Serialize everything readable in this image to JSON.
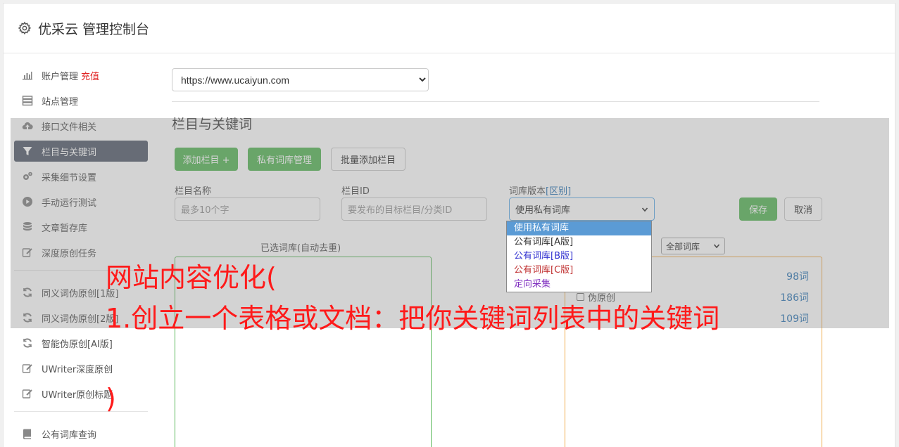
{
  "header": {
    "title": "优采云 管理控制台",
    "icon": "gear-icon"
  },
  "sidebar": {
    "items": [
      {
        "label": "账户管理",
        "icon": "bar-chart-icon",
        "extra": "充值"
      },
      {
        "label": "站点管理",
        "icon": "server-icon"
      },
      {
        "label": "接口文件相关",
        "icon": "cloud-upload-icon"
      },
      {
        "label": "栏目与关键词",
        "icon": "filter-icon",
        "active": true
      },
      {
        "label": "采集细节设置",
        "icon": "cogs-icon"
      },
      {
        "label": "手动运行测试",
        "icon": "play-circle-icon"
      },
      {
        "label": "文章暂存库",
        "icon": "database-icon"
      },
      {
        "label": "深度原创任务",
        "icon": "edit-icon"
      }
    ],
    "items2": [
      {
        "label": "同义词伪原创[1版]",
        "icon": "refresh-icon"
      },
      {
        "label": "同义词伪原创[2版]",
        "icon": "refresh-icon"
      },
      {
        "label": "智能伪原创[AI版]",
        "icon": "refresh-icon"
      },
      {
        "label": "UWriter深度原创",
        "icon": "edit-icon"
      },
      {
        "label": "UWriter原创标题",
        "icon": "edit-icon"
      }
    ],
    "items3": [
      {
        "label": "公有词库查询",
        "icon": "book-icon"
      }
    ]
  },
  "main": {
    "site_select_value": "https://www.ucaiyun.com",
    "section_title": "栏目与关键词",
    "buttons": {
      "add_column": "添加栏目 +",
      "private_lib": "私有词库管理",
      "batch_add": "批量添加栏目"
    },
    "form": {
      "name_label": "栏目名称",
      "name_placeholder": "最多10个字",
      "id_label": "栏目ID",
      "id_placeholder": "要发布的目标栏目/分类ID",
      "version_label": "词库版本",
      "version_diff": "[区别]",
      "version_value": "使用私有词库",
      "save": "保存",
      "cancel": "取消"
    },
    "version_options": [
      "使用私有词库",
      "公有词库[A版]",
      "公有词库[B版]",
      "公有词库[C版]",
      "定向采集"
    ],
    "selected_caption": "已选词库(自动去重)",
    "all_libs_select": "全部词库",
    "libraries": [
      {
        "name": "",
        "count": "98词"
      },
      {
        "name": "伪原创",
        "count": "186词"
      },
      {
        "name": "",
        "count": "109词"
      }
    ]
  },
  "overlay_text": {
    "line1": "网站内容优化(",
    "line2": "1.创立一个表格或文档：把你关键词列表中的关键词",
    "line3": ")"
  }
}
